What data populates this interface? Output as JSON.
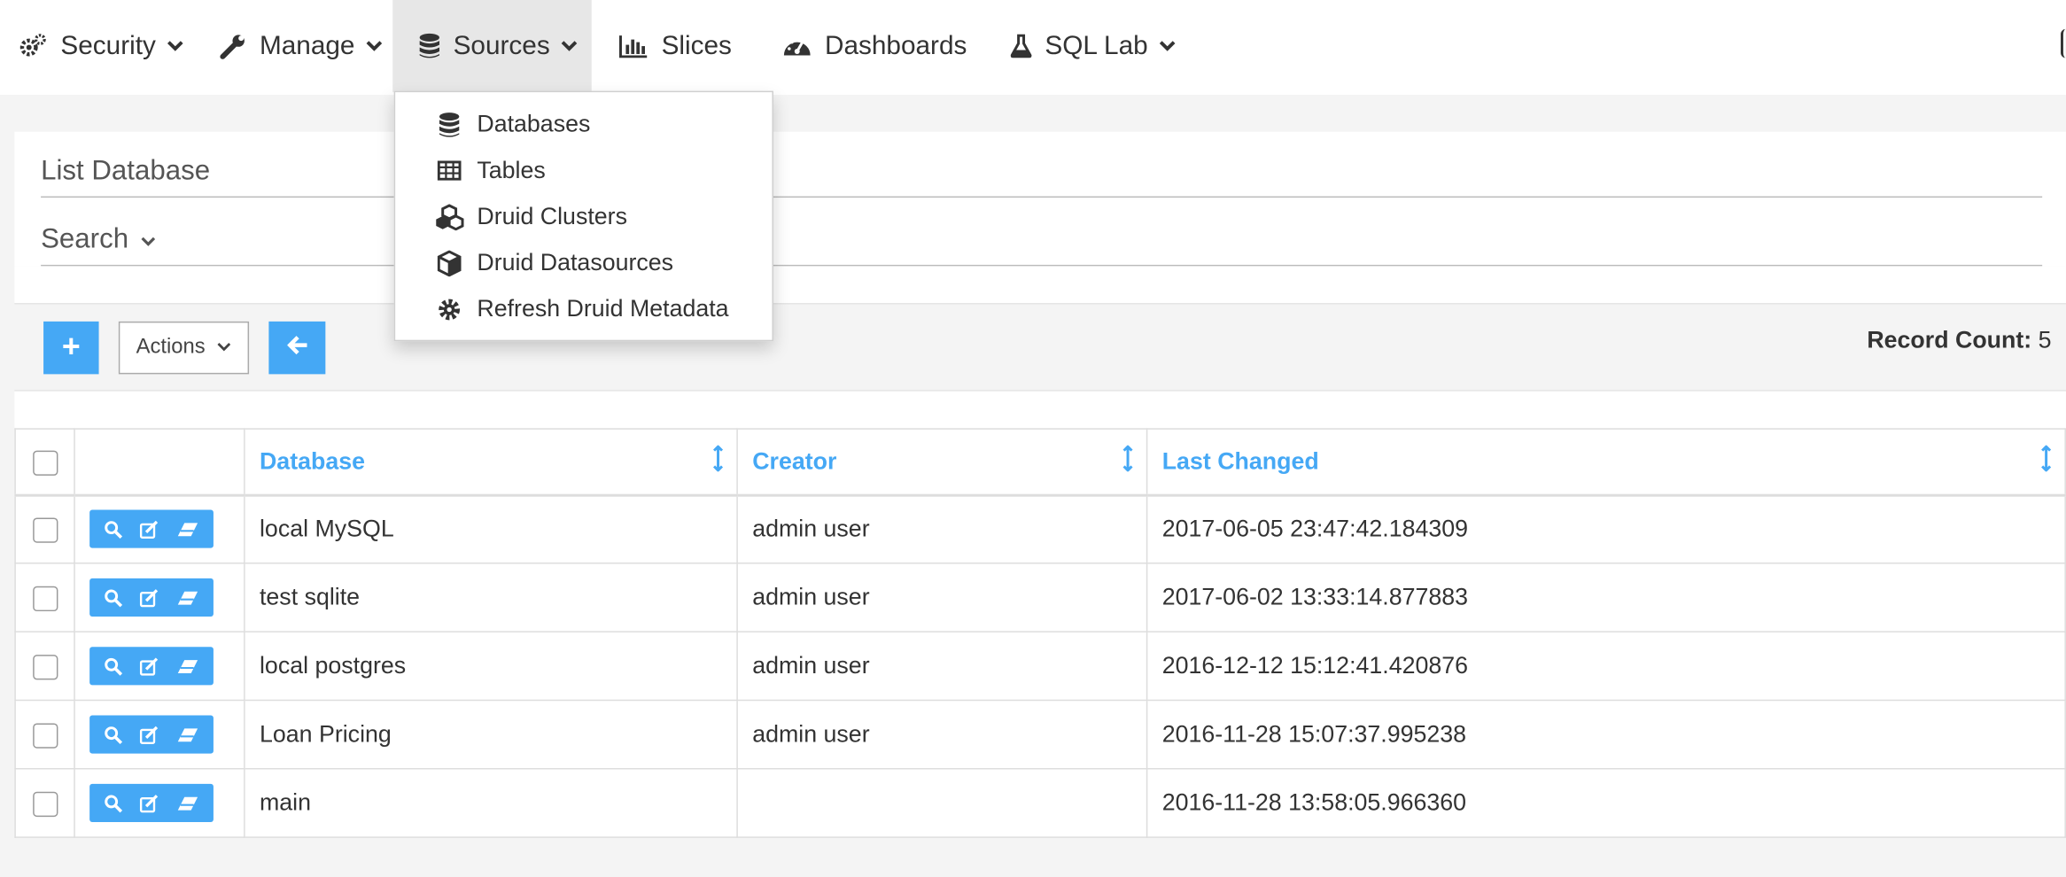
{
  "nav": {
    "security": "Security",
    "manage": "Manage",
    "sources": "Sources",
    "slices": "Slices",
    "dashboards": "Dashboards",
    "sql_lab": "SQL Lab"
  },
  "sources_menu": {
    "items": [
      {
        "label": "Databases",
        "icon": "database-icon"
      },
      {
        "label": "Tables",
        "icon": "table-icon"
      },
      {
        "label": "Druid Clusters",
        "icon": "cubes-icon"
      },
      {
        "label": "Druid Datasources",
        "icon": "cube-icon"
      },
      {
        "label": "Refresh Druid Metadata",
        "icon": "cog-icon"
      }
    ]
  },
  "page": {
    "title": "List Database",
    "search_label": "Search"
  },
  "toolbar": {
    "add_label": "+",
    "actions_label": "Actions",
    "record_count_label": "Record Count:",
    "record_count_value": "5"
  },
  "table": {
    "columns": [
      "Database",
      "Creator",
      "Last Changed"
    ],
    "rows": [
      {
        "database": "local MySQL",
        "creator": "admin user",
        "changed": "2017-06-05 23:47:42.184309"
      },
      {
        "database": "test sqlite",
        "creator": "admin user",
        "changed": "2017-06-02 13:33:14.877883"
      },
      {
        "database": "local postgres",
        "creator": "admin user",
        "changed": "2016-12-12 15:12:41.420876"
      },
      {
        "database": "Loan Pricing",
        "creator": "admin user",
        "changed": "2016-11-28 15:07:37.995238"
      },
      {
        "database": "main",
        "creator": "",
        "changed": "2016-11-28 13:58:05.966360"
      }
    ]
  },
  "colors": {
    "accent": "#45a8f5",
    "active_nav_bg": "#e7e7e7",
    "page_bg": "#f4f4f4"
  }
}
